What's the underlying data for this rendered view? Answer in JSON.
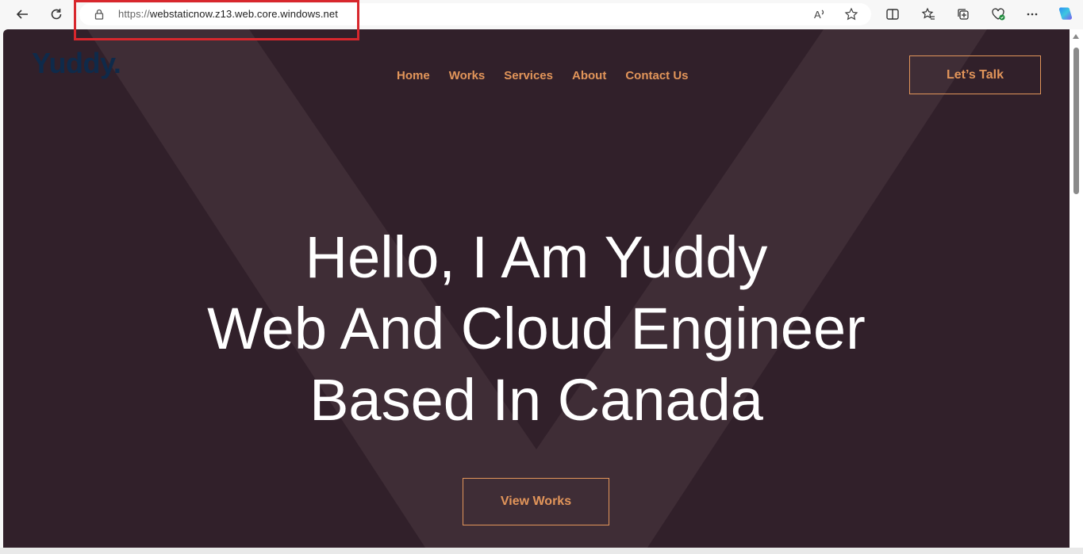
{
  "browser": {
    "url_scheme": "https://",
    "url_host": "webstaticnow.z13.web.core.windows.net",
    "icons": {
      "back": "back-arrow-icon",
      "refresh": "refresh-icon",
      "lock": "lock-icon",
      "read_aloud": "read-aloud-icon",
      "favorite": "star-icon",
      "split_screen": "split-screen-icon",
      "favorites": "favorites-icon",
      "collections": "collections-icon",
      "health": "browser-essentials-icon",
      "more": "more-icon",
      "copilot": "copilot-icon"
    }
  },
  "site": {
    "logo": "Yuddy",
    "logo_dot": ".",
    "nav": [
      "Home",
      "Works",
      "Services",
      "About",
      "Contact Us"
    ],
    "cta_top": "Let’s Talk",
    "hero_lines": [
      "Hello, I Am Yuddy",
      "Web And Cloud Engineer",
      "Based In Canada"
    ],
    "cta_main": "View Works"
  },
  "colors": {
    "background": "#31202a",
    "accent": "#e2955a",
    "logo": "#0f2a4a",
    "highlight": "#d8272d"
  }
}
